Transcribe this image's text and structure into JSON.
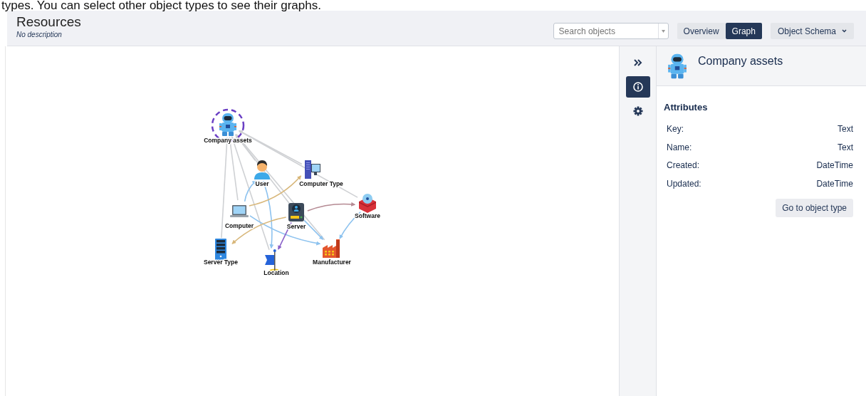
{
  "caption": "types. You can select other object types to see their graphs.",
  "header": {
    "title": "Resources",
    "description": "No description"
  },
  "search": {
    "placeholder": "Search objects"
  },
  "view_tabs": [
    {
      "label": "Overview",
      "selected": false
    },
    {
      "label": "Graph",
      "selected": true
    }
  ],
  "schema_menu": {
    "label": "Object Schema"
  },
  "graph": {
    "nodes": [
      {
        "label": "Company assets",
        "kind": "astronaut",
        "selected": true
      },
      {
        "label": "User",
        "kind": "person",
        "selected": false
      },
      {
        "label": "Computer Type",
        "kind": "desktop",
        "selected": false
      },
      {
        "label": "Software",
        "kind": "software",
        "selected": false
      },
      {
        "label": "Computer",
        "kind": "laptop",
        "selected": false
      },
      {
        "label": "Server",
        "kind": "drive",
        "selected": false
      },
      {
        "label": "Server Type",
        "kind": "rack",
        "selected": false
      },
      {
        "label": "Location",
        "kind": "flag",
        "selected": false
      },
      {
        "label": "Manufacturer",
        "kind": "factory",
        "selected": false
      }
    ]
  },
  "side_toolbar": [
    {
      "kind": "collapse",
      "selected": false
    },
    {
      "kind": "info",
      "selected": true
    },
    {
      "kind": "settings",
      "selected": false
    }
  ],
  "details": {
    "title": "Company assets",
    "section": "Attributes",
    "attributes": [
      {
        "name": "Key:",
        "type": "Text"
      },
      {
        "name": "Name:",
        "type": "Text"
      },
      {
        "name": "Created:",
        "type": "DateTime"
      },
      {
        "name": "Updated:",
        "type": "DateTime"
      }
    ],
    "button": "Go to object type"
  }
}
